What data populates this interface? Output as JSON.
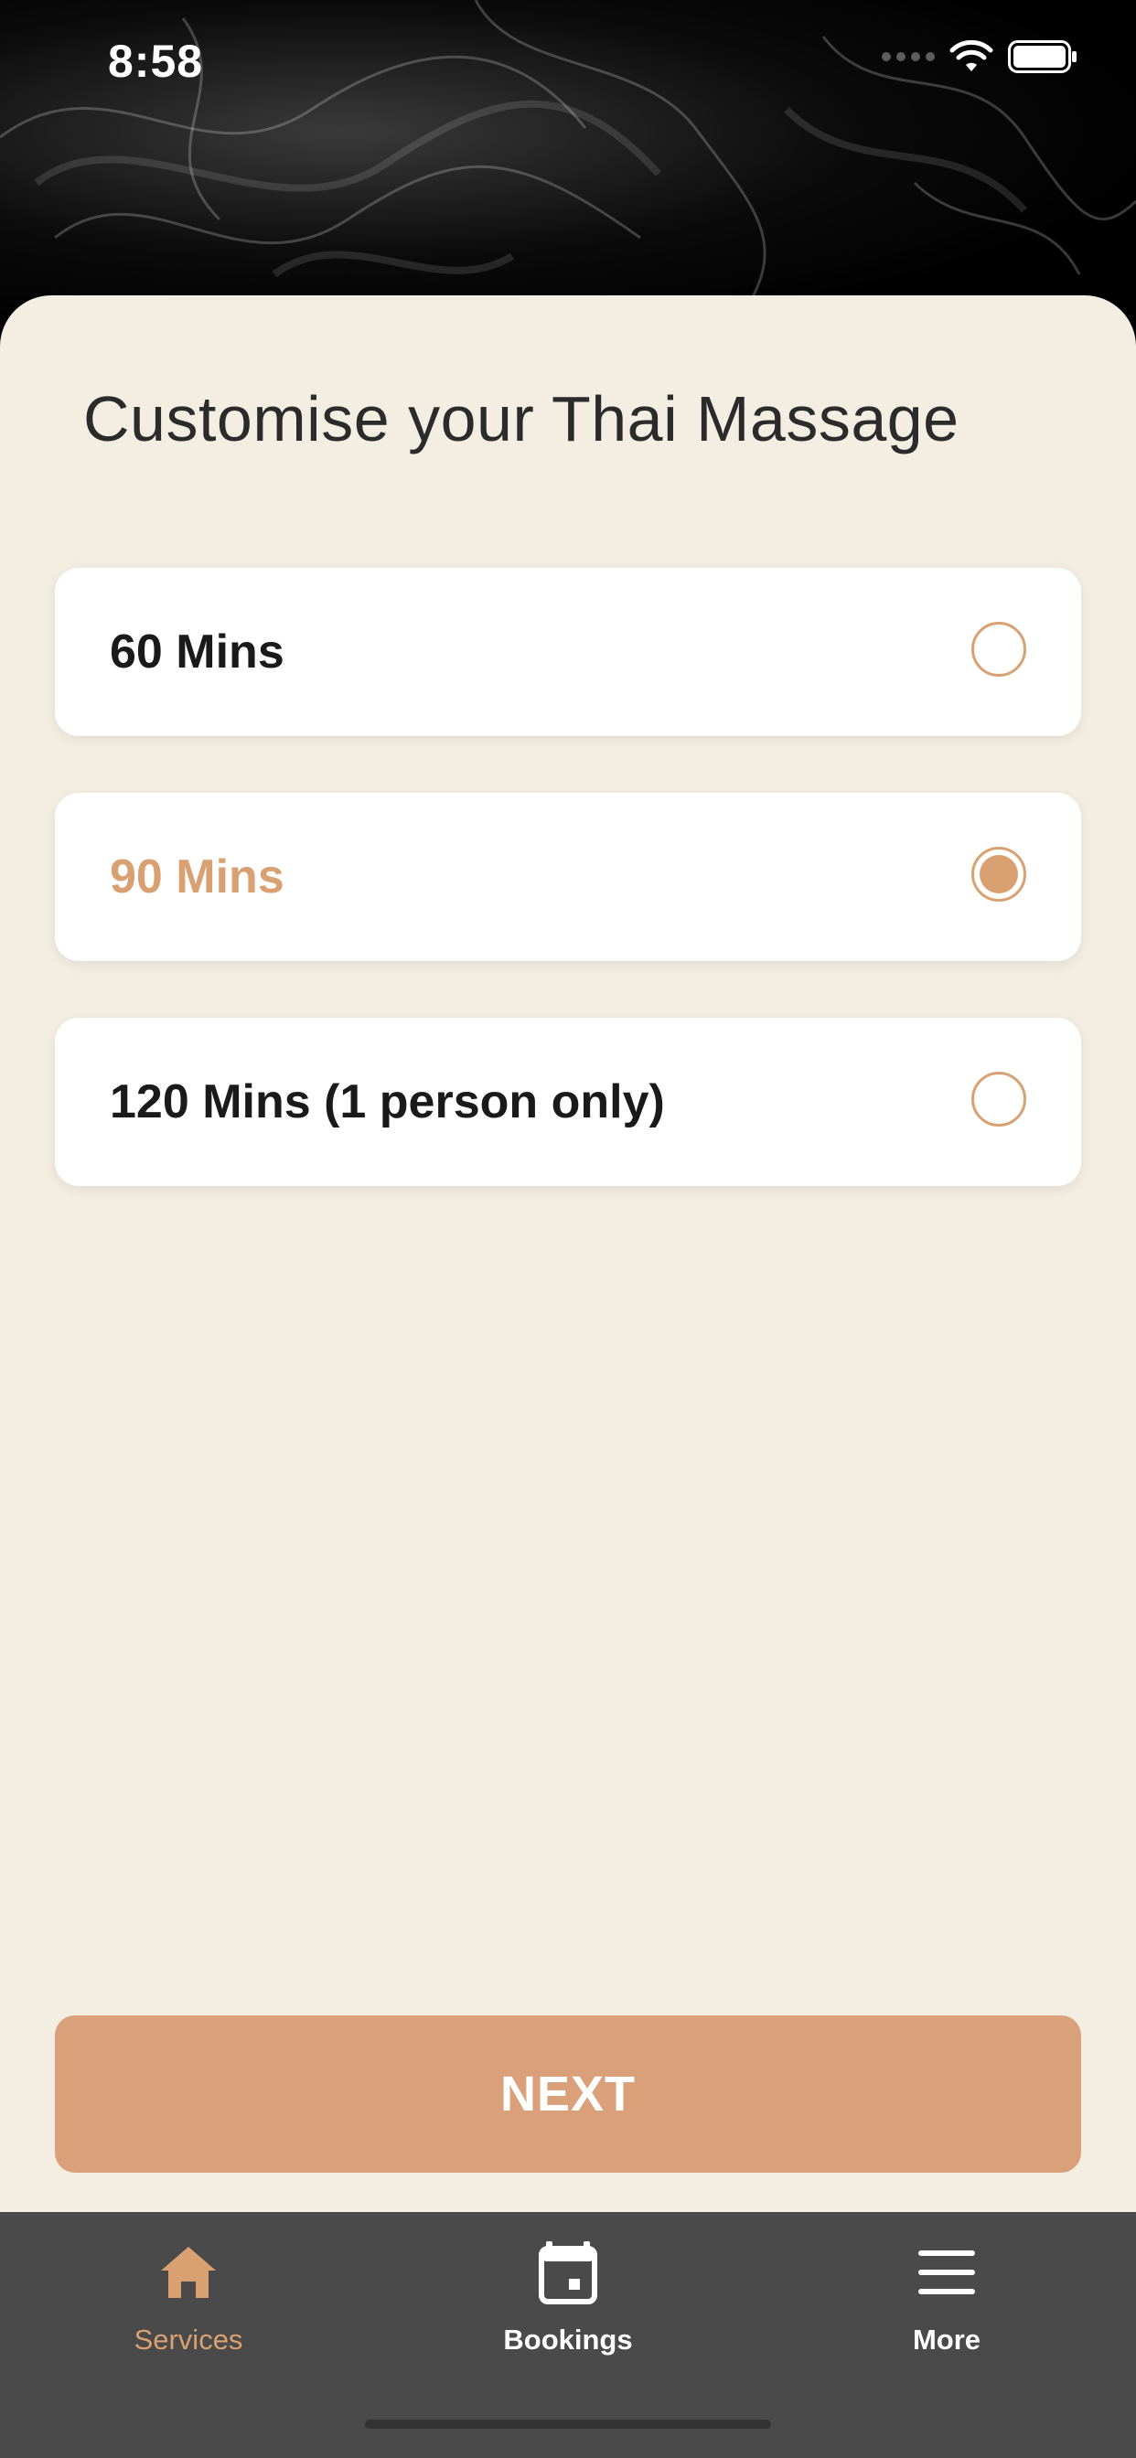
{
  "status_bar": {
    "time": "8:58"
  },
  "page": {
    "title": "Customise your Thai Massage"
  },
  "options": [
    {
      "label": "60 Mins",
      "selected": false
    },
    {
      "label": "90 Mins",
      "selected": true
    },
    {
      "label": "120 Mins (1 person only)",
      "selected": false
    }
  ],
  "actions": {
    "next_label": "NEXT"
  },
  "tabbar": {
    "tabs": [
      {
        "label": "Services",
        "icon": "home-icon",
        "active": true
      },
      {
        "label": "Bookings",
        "icon": "calendar-icon",
        "active": false
      },
      {
        "label": "More",
        "icon": "menu-icon",
        "active": false
      }
    ]
  },
  "colors": {
    "accent": "#d9a072",
    "sheet_background": "#f4eee2",
    "tabbar_background": "#4a4a4a"
  }
}
